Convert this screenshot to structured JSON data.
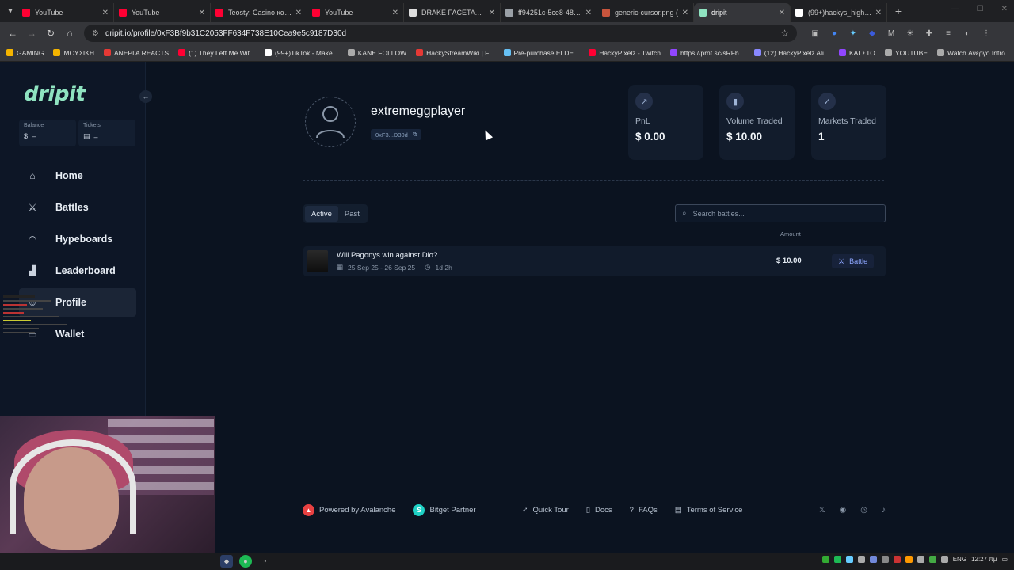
{
  "browser": {
    "tabs": [
      {
        "title": "YouTube",
        "color": "#ff0033"
      },
      {
        "title": "YouTube",
        "color": "#ff0033"
      },
      {
        "title": "Teosty: Casino και 'K",
        "color": "#ff0033"
      },
      {
        "title": "YouTube",
        "color": "#ff0033"
      },
      {
        "title": "DRAKE FACETAT - Go",
        "color": "#dddddd"
      },
      {
        "title": "ff94251c-5ce8-4871-",
        "color": "#9aa0a6"
      },
      {
        "title": "generic-cursor.png (",
        "color": "#c8553d"
      },
      {
        "title": "dripit",
        "color": "#8fe3c0"
      },
      {
        "title": "(99+)hackys_highligh",
        "color": "#ffffff"
      }
    ],
    "url": "dripit.io/profile/0xF3Bf9b31C2053FF634F738E10Ceа9e5c9187D30d",
    "bookmarks": [
      "GAMING",
      "ΜΟΥΣΙΚΗ",
      "ΑΝΕΡΓΑ REACTS",
      "(1) They Left Me Wit...",
      "(99+)TikTok - Make...",
      "KANE FOLLOW",
      "HackyStreamWiki | F...",
      "Pre-purchase ELDE...",
      "HackyPixelz - Twitch",
      "https://prnt.sc/sRFb...",
      "(12) HackyPixelz Ali...",
      "ΚΑΙ ΣΤΟ",
      "YOUTUBE",
      "Watch Ανεργο Intro..."
    ]
  },
  "sidebar": {
    "logo": "dripit",
    "balance_label": "Balance",
    "balance_value": "–",
    "tickets_label": "Tickets",
    "tickets_value": "–",
    "items": [
      {
        "label": "Home"
      },
      {
        "label": "Battles"
      },
      {
        "label": "Hypeboards"
      },
      {
        "label": "Leaderboard"
      },
      {
        "label": "Profile"
      },
      {
        "label": "Wallet"
      }
    ]
  },
  "profile": {
    "username": "extremeggplayer",
    "address_short": "0xF3...D30d"
  },
  "metrics": [
    {
      "label": "PnL",
      "value": "$ 0.00",
      "icon": "trend-up-icon"
    },
    {
      "label": "Volume Traded",
      "value": "$ 10.00",
      "icon": "bar-chart-icon"
    },
    {
      "label": "Markets Traded",
      "value": "1",
      "icon": "double-check-icon"
    }
  ],
  "battles": {
    "tabs": [
      "Active",
      "Past"
    ],
    "search_placeholder": "Search battles...",
    "amount_header": "Amount",
    "rows": [
      {
        "title": "Will Pagonys win against Dio?",
        "dates": "25 Sep 25 - 26 Sep 25",
        "remaining": "1d 2h",
        "amount": "$ 10.00",
        "action": "Battle"
      }
    ]
  },
  "footer": {
    "powered": "Powered by Avalanche",
    "partner": "Bitget Partner",
    "links": [
      "Quick Tour",
      "Docs",
      "FAQs",
      "Terms of Service"
    ]
  },
  "taskbar": {
    "lang": "ENG",
    "time": "12:27 πμ"
  }
}
